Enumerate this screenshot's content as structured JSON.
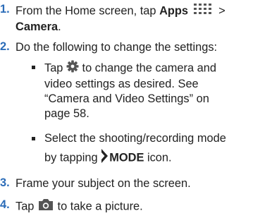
{
  "steps": [
    {
      "num": "1.",
      "text_a": "From the Home screen, tap ",
      "bold_a": "Apps",
      "text_b": " >",
      "bold_b": "Camera",
      "text_c": "."
    },
    {
      "num": "2.",
      "text": "Do the following to change the settings:"
    },
    {
      "num": "3.",
      "text": "Frame your subject on the screen."
    },
    {
      "num": "4.",
      "text_a": "Tap ",
      "text_b": " to take a picture."
    }
  ],
  "bullets": [
    {
      "line1_a": "Tap ",
      "line1_b": " to change the camera and",
      "line2": "video settings as desired. See",
      "line3": "“Camera and Video Settings” on",
      "line4": "page 58."
    },
    {
      "line1": "Select the shooting/recording mode",
      "line2_a": "by tapping ",
      "line2_bold": "MODE",
      "line2_b": " icon."
    }
  ],
  "icons": [
    "apps-grid-icon",
    "gear-icon",
    "chevron-right-icon",
    "camera-icon"
  ]
}
